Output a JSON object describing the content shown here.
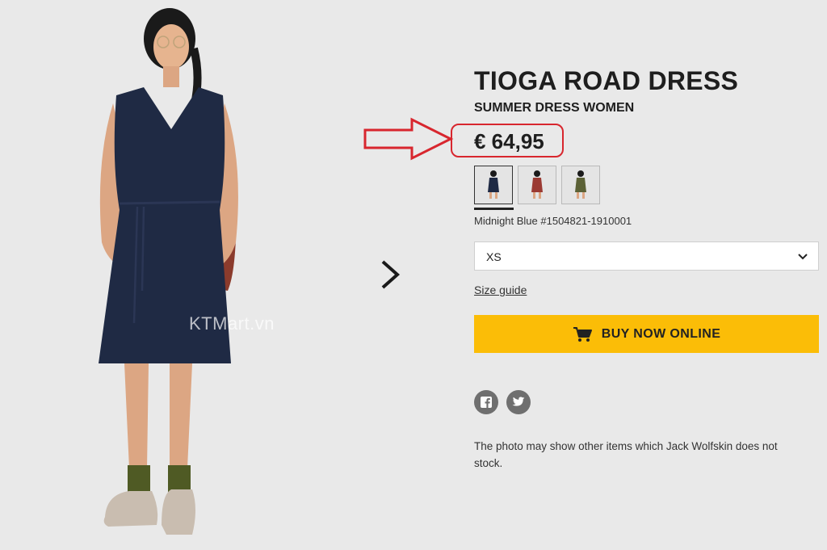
{
  "product": {
    "title": "TIOGA ROAD DRESS",
    "subtitle": "SUMMER DRESS WOMEN",
    "price": "€ 64,95",
    "color_label": "Midnight Blue #1504821-1910001",
    "size_selected": "XS",
    "size_guide_label": "Size guide",
    "buy_label": "BUY NOW ONLINE",
    "disclaimer": "The photo may show other items which Jack Wolfskin does not stock."
  },
  "gallery": {
    "watermark": "KTMart.vn"
  },
  "swatches": [
    {
      "name": "midnight-blue",
      "color": "#1f2a44",
      "active": true
    },
    {
      "name": "red",
      "color": "#9b3a33",
      "active": false
    },
    {
      "name": "olive",
      "color": "#5b6136",
      "active": false
    }
  ],
  "icons": {
    "next": "chevron-right-icon",
    "cart": "cart-icon",
    "dropdown": "chevron-down-icon",
    "facebook": "facebook-icon",
    "twitter": "twitter-icon",
    "annotation": "red-arrow-icon"
  },
  "colors": {
    "accent": "#fbbd07",
    "annotation": "#d8262e",
    "background": "#e9e9e9"
  }
}
